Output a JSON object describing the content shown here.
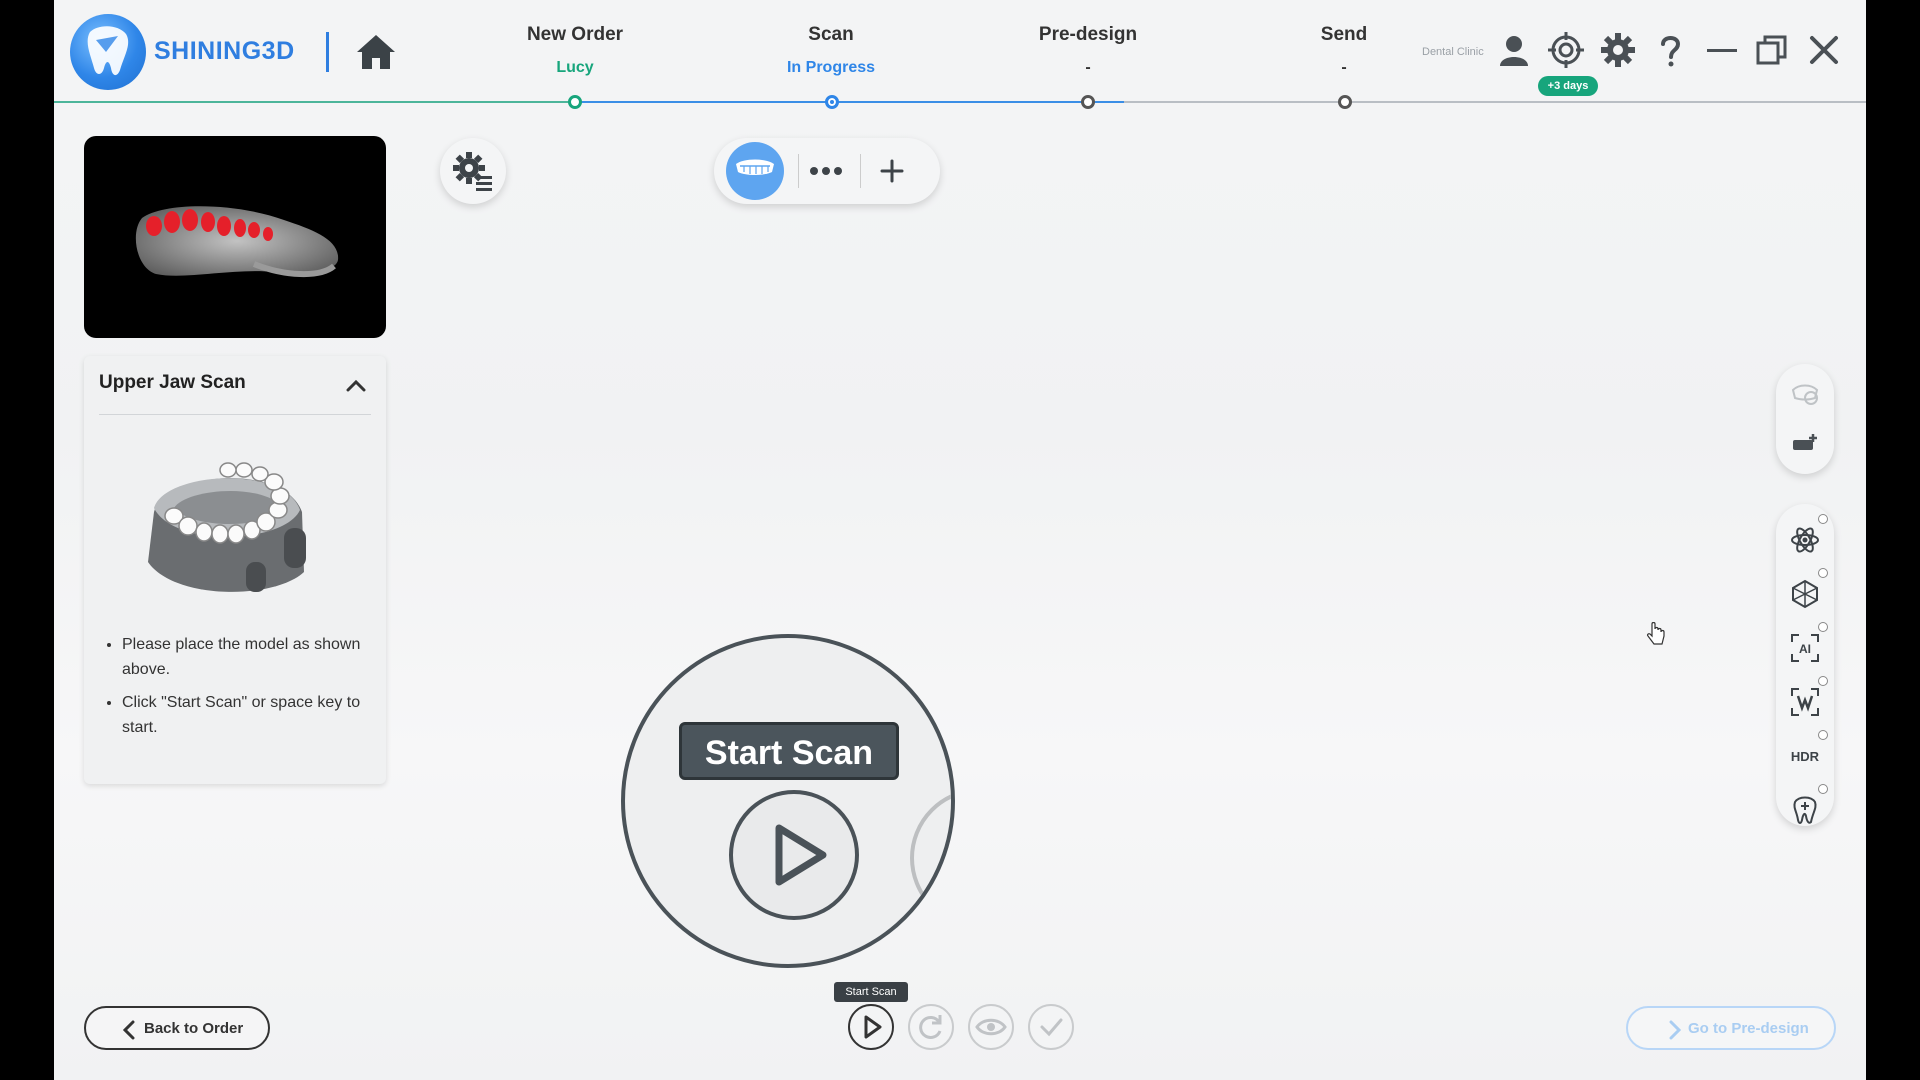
{
  "app": {
    "brand": "SHINING3D",
    "clinic": "Dental Clinic",
    "license_badge": "+3 days"
  },
  "steps": [
    {
      "title": "New Order",
      "sub": "Lucy",
      "sub_color": "#17a57c",
      "state": "done"
    },
    {
      "title": "Scan",
      "sub": "In Progress",
      "sub_color": "#2f86e8",
      "state": "active"
    },
    {
      "title": "Pre-design",
      "sub": "-",
      "sub_color": "#333333",
      "state": "pending"
    },
    {
      "title": "Send",
      "sub": "-",
      "sub_color": "#333333",
      "state": "pending"
    }
  ],
  "header_icons": [
    "home-icon",
    "user-icon",
    "target-icon",
    "gear-icon",
    "help-icon",
    "minimize-icon",
    "restore-icon",
    "close-icon"
  ],
  "scan_card": {
    "title": "Upper Jaw Scan",
    "instructions": [
      "Please place the model as shown above.",
      "Click \"Start Scan\" or space key to start."
    ]
  },
  "zoom_callout": {
    "label": "Start Scan"
  },
  "right_tools": [
    "texture-icon",
    "trim-icon",
    "atom-icon",
    "mesh-icon",
    "ai-icon",
    "scan-filter-icon",
    "hdr-icon",
    "tooth-icon"
  ],
  "bottom": {
    "back_label": "Back to Order",
    "tooltip": "Start Scan",
    "next_label": "Go to Pre-design"
  },
  "colors": {
    "accent": "#2f86e8",
    "done": "#17a57c"
  }
}
